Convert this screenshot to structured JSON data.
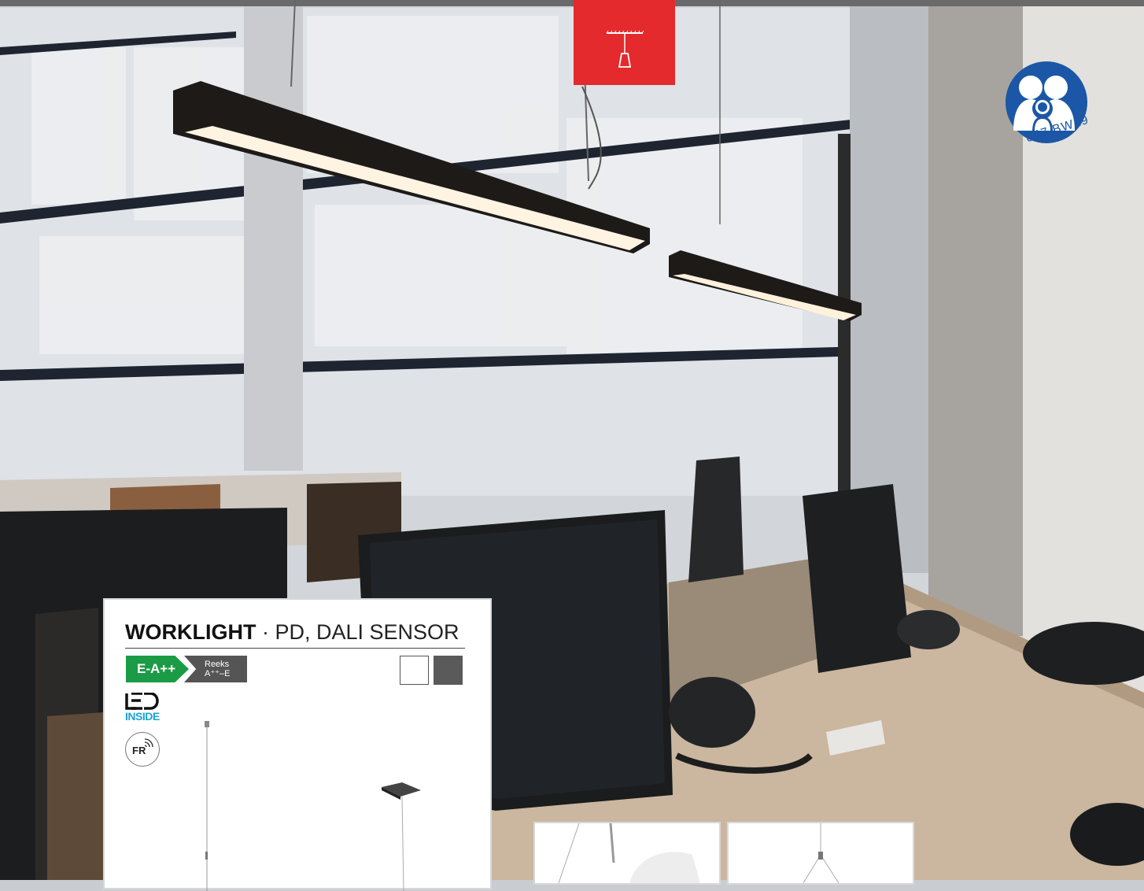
{
  "card": {
    "title_main": "WORKLIGHT",
    "title_sub": " · PD, DALI SENSOR",
    "energy_class": "E-A++",
    "energy_range_label": "Reeks",
    "energy_range": "A⁺⁺–E",
    "led_label": "INSIDE",
    "fr_label": "FR",
    "swatches": [
      "#ffffff",
      "#5a5a5a"
    ]
  },
  "badge": {
    "code": "847 BW19",
    "color": "#1b57a6"
  },
  "ceiling_tab": {
    "icon": "ceiling-pendant-icon",
    "color": "#e42a2d"
  }
}
